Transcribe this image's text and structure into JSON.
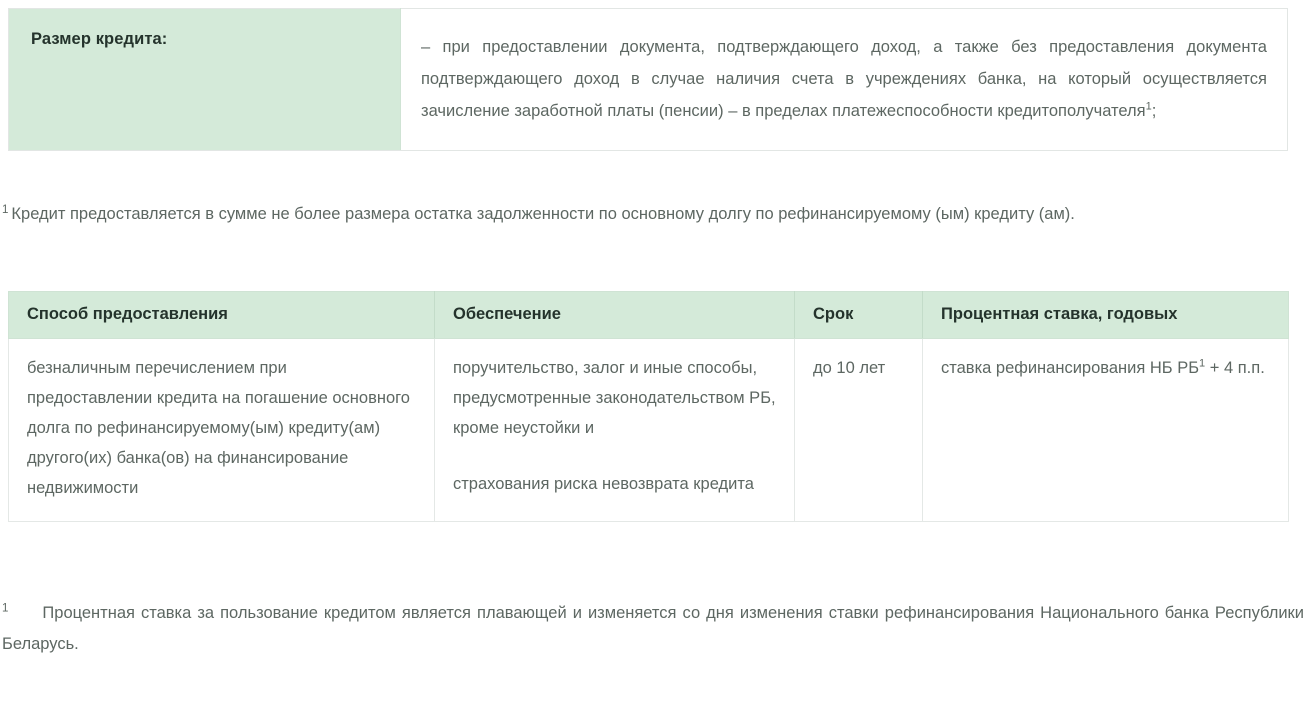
{
  "colors": {
    "accent_green_bg": "#d4ead9",
    "header_text": "#24332c",
    "body_text": "#5d6762",
    "table_border": "#e4e8e6",
    "page_bg": "#ffffff"
  },
  "loan_size_block": {
    "label": "Размер кредита:",
    "paragraph": "– при предоставлении документа, подтверждающего доход, а также без предоставления документа подтверждающего  доход в случае наличия счета в учреждениях банка, на который осуществляется зачисление заработной платы (пенсии) – в пределах платежеспособности кредитополучателя",
    "footnote_marker": "1",
    "paragraph_tail": ";"
  },
  "footnote_loan_size": {
    "marker": "1",
    "text": "Кредит предоставляется в сумме не более размера остатка задолженности по основному долгу по рефинансируемому (ым) кредиту (ам)."
  },
  "conditions_table": {
    "columns": [
      "Способ предоставления",
      "Обеспечение",
      "Срок",
      "Процентная ставка, годовых"
    ],
    "rows": [
      {
        "method": "безналичным перечислением при предоставлении кредита на погашение основного долга по рефинансируемому(ым) кредиту(ам) другого(их) банка(ов) на финансирование недвижимости",
        "collateral_part_1": "поручительство, залог и иные способы, предусмотренные законодательством РБ, кроме неустойки и",
        "collateral_part_2": "страхования риска невозврата кредита",
        "term": "до 10 лет",
        "rate_prefix": "ставка рефинансирования НБ РБ",
        "rate_footnote_marker": "1",
        "rate_suffix": " + 4 п.п."
      }
    ]
  },
  "footnote_rate": {
    "marker": "1",
    "text": "Процентная ставка за пользование кредитом является плавающей и изменяется со дня изменения ставки рефинансирования Национального банка Республики Беларусь."
  }
}
